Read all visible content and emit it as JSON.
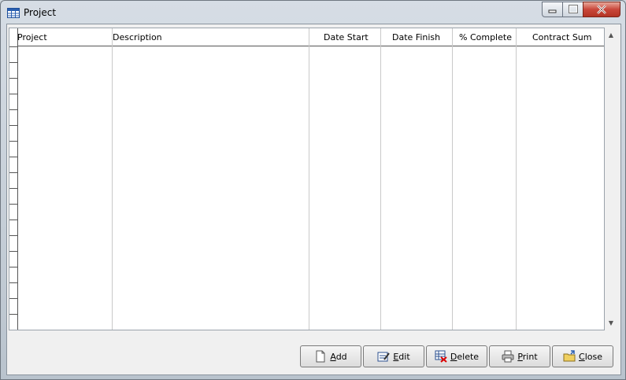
{
  "window": {
    "title": "Project",
    "icon": "table-icon"
  },
  "grid": {
    "columns": [
      "Project",
      "Description",
      "Date Start",
      "Date Finish",
      "% Complete",
      "Contract Sum"
    ],
    "rows": []
  },
  "buttons": {
    "add": "Add",
    "edit": "Edit",
    "delete": "Delete",
    "print": "Print",
    "close": "Close"
  }
}
